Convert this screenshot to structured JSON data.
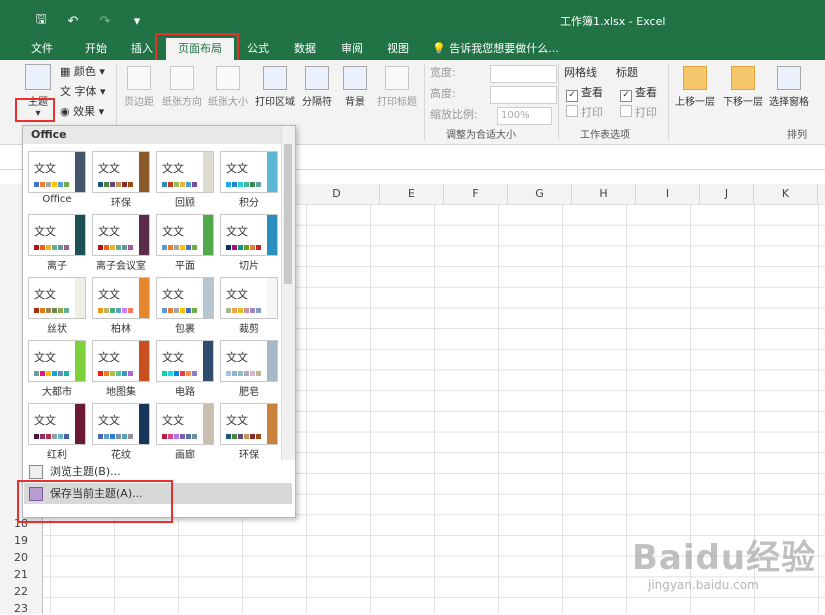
{
  "window": {
    "title": "工作簿1.xlsx - Excel"
  },
  "qat": {
    "save": "🖫",
    "undo": "↶",
    "redo": "↷",
    "more": "▾"
  },
  "tabs": [
    {
      "label": "文件"
    },
    {
      "label": "开始"
    },
    {
      "label": "插入"
    },
    {
      "label": "页面布局"
    },
    {
      "label": "公式"
    },
    {
      "label": "数据"
    },
    {
      "label": "审阅"
    },
    {
      "label": "视图"
    }
  ],
  "tellme": "告诉我您想要做什么...",
  "ribbon": {
    "theme_label": "主题",
    "theme_chevron": "▾",
    "colors": "颜色",
    "fonts": "字体",
    "effects": "效果",
    "margins": "页边距",
    "orientation": "纸张方向",
    "size": "纸张大小",
    "print_area": "打印区域",
    "breaks": "分隔符",
    "background": "背景",
    "print_titles": "打印标题",
    "width": "宽度:",
    "height": "高度:",
    "scale": "缩放比例:",
    "scale_value": "100%",
    "scale_group": "调整为合适大小",
    "gridlines": "网格线",
    "headings": "标题",
    "view": "查看",
    "print": "打印",
    "sheet_options_group": "工作表选项",
    "bring_forward": "上移一层",
    "send_backward": "下移一层",
    "selection_pane": "选择窗格",
    "arrange_group": "排列"
  },
  "columns": [
    "D",
    "E",
    "F",
    "G",
    "H",
    "I",
    "J",
    "K"
  ],
  "rows": [
    "18",
    "19",
    "20",
    "21",
    "22",
    "23"
  ],
  "dropdown": {
    "header": "Office",
    "sample": "文文",
    "themes": [
      {
        "name": "Office",
        "band": "#44546a",
        "swatches": [
          "#4472c4",
          "#ed7d31",
          "#a5a5a5",
          "#ffc000",
          "#5b9bd5",
          "#70ad47"
        ]
      },
      {
        "name": "环保",
        "band": "#8b5a2b",
        "swatches": [
          "#1b587c",
          "#4e8542",
          "#604878",
          "#c19859",
          "#8a2a2b",
          "#9c4c0d"
        ]
      },
      {
        "name": "回顾",
        "band": "#dfddd2",
        "swatches": [
          "#2e8bc0",
          "#c53b2b",
          "#9bbb59",
          "#e8b540",
          "#4d9ed2",
          "#7b4b96"
        ]
      },
      {
        "name": "积分",
        "band": "#5bb7d3",
        "swatches": [
          "#1cade4",
          "#2683c6",
          "#27ced7",
          "#42ba97",
          "#3e8853",
          "#62a39f"
        ]
      },
      {
        "name": "离子",
        "band": "#1e5155",
        "swatches": [
          "#b01513",
          "#ea6312",
          "#e6b729",
          "#6aac90",
          "#5f9c9d",
          "#9e5e9b"
        ]
      },
      {
        "name": "离子会议室",
        "band": "#5c2c4d",
        "swatches": [
          "#b01513",
          "#ea6312",
          "#e6b729",
          "#6aac90",
          "#5f9c9d",
          "#9e5e9b"
        ]
      },
      {
        "name": "平面",
        "band": "#52a84b",
        "swatches": [
          "#5b9bd5",
          "#ed7d31",
          "#a5a5a5",
          "#ffc000",
          "#4472c4",
          "#70ad47"
        ]
      },
      {
        "name": "切片",
        "band": "#2a8fbd",
        "swatches": [
          "#052f61",
          "#a50e82",
          "#14967c",
          "#6a9e1f",
          "#e87d37",
          "#c62324"
        ]
      },
      {
        "name": "丝状",
        "band": "#f0efe6",
        "swatches": [
          "#a53010",
          "#de7e18",
          "#9f8351",
          "#728653",
          "#92aa4c",
          "#6aac91"
        ]
      },
      {
        "name": "柏林",
        "band": "#e6872e",
        "swatches": [
          "#f09415",
          "#c1b56b",
          "#4baf73",
          "#5aa6c0",
          "#d17df9",
          "#fa7e5c"
        ]
      },
      {
        "name": "包裹",
        "band": "#b7c5d0",
        "swatches": [
          "#5b9bd5",
          "#ed7d31",
          "#a5a5a5",
          "#ffc000",
          "#4472c4",
          "#70ad47"
        ]
      },
      {
        "name": "裁剪",
        "band": "#f5f5f5",
        "swatches": [
          "#a5b592",
          "#f3a447",
          "#e7bc29",
          "#d092a7",
          "#9c85c0",
          "#809ec2"
        ]
      },
      {
        "name": "大都市",
        "band": "#7fd13b",
        "swatches": [
          "#62a39f",
          "#ea157a",
          "#feb80a",
          "#00addc",
          "#738ac8",
          "#1ab39f"
        ]
      },
      {
        "name": "地图集",
        "band": "#c94f1e",
        "swatches": [
          "#f81b02",
          "#fc7715",
          "#afbf41",
          "#50c49f",
          "#3b95c4",
          "#b560d4"
        ]
      },
      {
        "name": "电路",
        "band": "#2f4c6e",
        "swatches": [
          "#03d4a8",
          "#21d6e0",
          "#0087e6",
          "#e83b46",
          "#ff8d3a",
          "#8a7cd6"
        ]
      },
      {
        "name": "肥皂",
        "band": "#a6b7c8",
        "swatches": [
          "#a3c4e4",
          "#91b4c8",
          "#87c3c0",
          "#b0a7c4",
          "#d6b7c9",
          "#c5b58f"
        ]
      },
      {
        "name": "红利",
        "band": "#6b1a36",
        "swatches": [
          "#4d1434",
          "#903163",
          "#b2324b",
          "#969fa7",
          "#66b1ce",
          "#40619d"
        ]
      },
      {
        "name": "花纹",
        "band": "#18365a",
        "swatches": [
          "#4a66ac",
          "#629dd1",
          "#297fd5",
          "#7f8fa9",
          "#5aa2ae",
          "#9d90a0"
        ]
      },
      {
        "name": "画廊",
        "band": "#c7bfb0",
        "swatches": [
          "#b71e42",
          "#de478e",
          "#bc72f0",
          "#795faf",
          "#586ea6",
          "#6892a0"
        ]
      },
      {
        "name": "环保",
        "band": "#c8843c",
        "swatches": [
          "#1b587c",
          "#4e8542",
          "#604878",
          "#c19859",
          "#8a2a2b",
          "#9c4c0d"
        ]
      }
    ],
    "browse": "浏览主题(B)...",
    "save": "保存当前主题(A)..."
  },
  "watermark": {
    "brand": "Baidu经验",
    "url": "jingyan.baidu.com"
  },
  "colors": {
    "excel_green": "#217346",
    "highlight_red": "#e8312f"
  }
}
